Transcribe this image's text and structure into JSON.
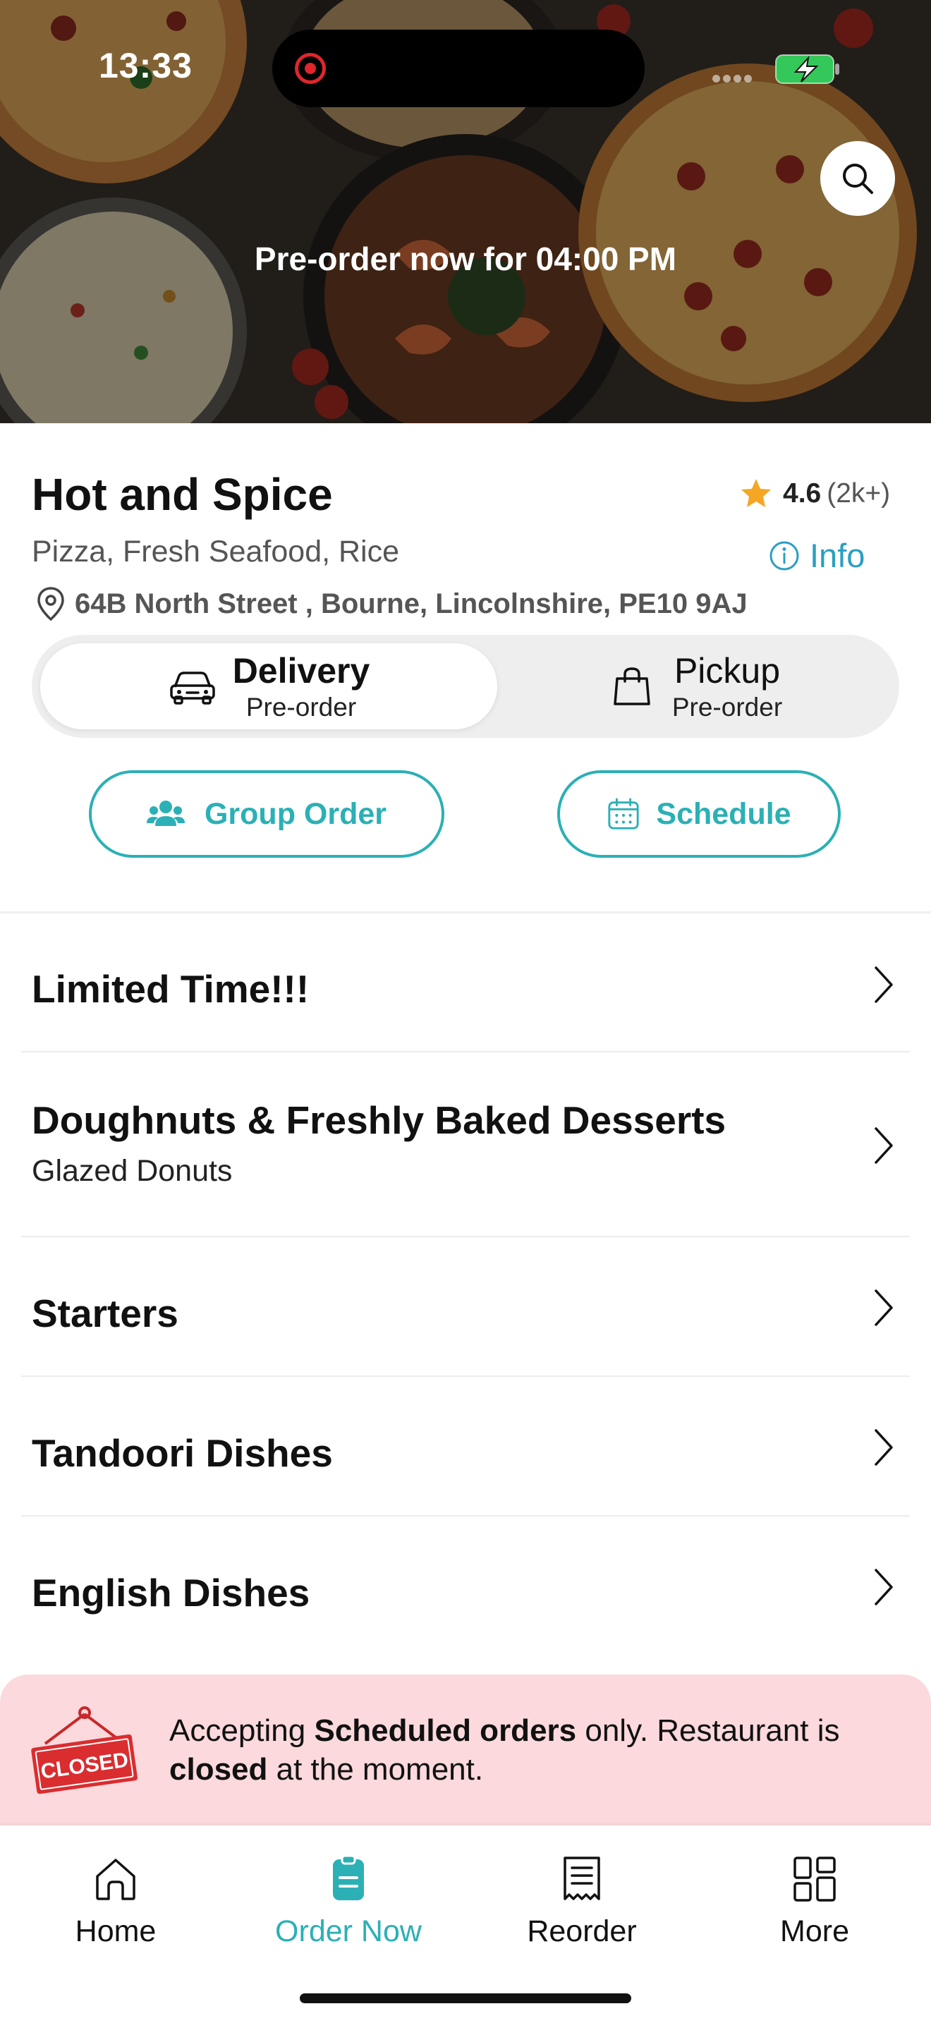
{
  "status_bar": {
    "time": "13:33"
  },
  "hero": {
    "preorder_text": "Pre-order now for 04:00 PM"
  },
  "restaurant": {
    "name": "Hot and Spice",
    "rating": "4.6",
    "rating_count": "(2k+)",
    "cuisines": "Pizza, Fresh Seafood, Rice",
    "info_label": "Info",
    "address": "64B North Street , Bourne, Lincolnshire, PE10 9AJ"
  },
  "order_mode": {
    "delivery": {
      "label": "Delivery",
      "sub": "Pre-order",
      "icon": "car-icon",
      "selected": true
    },
    "pickup": {
      "label": "Pickup",
      "sub": "Pre-order",
      "icon": "shopping-bag-icon",
      "selected": false
    }
  },
  "actions": {
    "group_order": {
      "label": "Group Order",
      "icon": "group-icon"
    },
    "schedule": {
      "label": "Schedule",
      "icon": "calendar-icon"
    }
  },
  "menu": [
    {
      "title": "Limited Time!!!",
      "subtitle": ""
    },
    {
      "title": "Doughnuts & Freshly Baked Desserts",
      "subtitle": "Glazed Donuts"
    },
    {
      "title": "Starters",
      "subtitle": ""
    },
    {
      "title": "Tandoori Dishes",
      "subtitle": ""
    },
    {
      "title": "English Dishes",
      "subtitle": ""
    }
  ],
  "closed_notice": {
    "sign_text": "CLOSED",
    "part1": "Accepting ",
    "bold1": "Scheduled orders",
    "part2": " only. Restaurant is ",
    "bold2": "closed",
    "part3": " at the moment."
  },
  "tabs": [
    {
      "label": "Home",
      "icon": "home-icon",
      "active": false
    },
    {
      "label": "Order Now",
      "icon": "order-icon",
      "active": true
    },
    {
      "label": "Reorder",
      "icon": "receipt-icon",
      "active": false
    },
    {
      "label": "More",
      "icon": "grid-icon",
      "active": false
    }
  ],
  "colors": {
    "accent": "#2bb0b5",
    "info": "#2a9fc4",
    "star": "#f5a623",
    "closed_bg": "#fbd9dc",
    "closed_red": "#d92d30"
  }
}
